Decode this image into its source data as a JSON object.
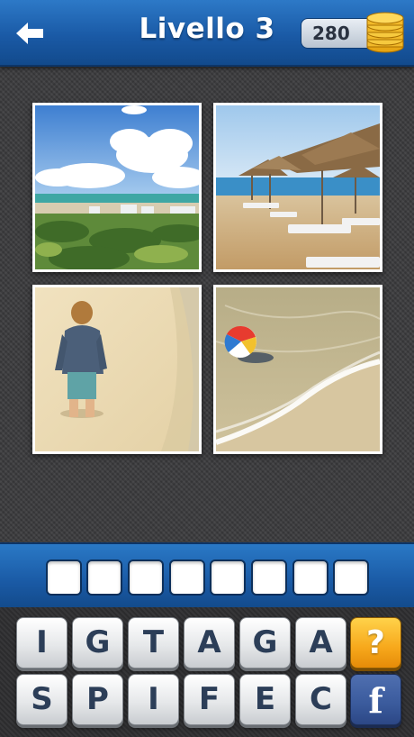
{
  "header": {
    "title": "Livello 3",
    "coins": "280",
    "back_icon": "back-arrow-icon",
    "coin_icon": "coin-stack-icon"
  },
  "photos": [
    {
      "label": "beach-dunes-photo"
    },
    {
      "label": "beach-umbrellas-photo"
    },
    {
      "label": "child-on-sand-photo"
    },
    {
      "label": "beach-ball-photo"
    }
  ],
  "answer": {
    "slots": [
      "",
      "",
      "",
      "",
      "",
      "",
      "",
      ""
    ]
  },
  "keyboard": {
    "row1": [
      "I",
      "G",
      "T",
      "A",
      "G",
      "A"
    ],
    "row2": [
      "S",
      "P",
      "I",
      "F",
      "E",
      "C"
    ],
    "hint_label": "?",
    "facebook_label": "f"
  },
  "colors": {
    "header_blue": "#1a5aa6",
    "hint_orange": "#f7a81b",
    "facebook_blue": "#3a5a9c"
  }
}
